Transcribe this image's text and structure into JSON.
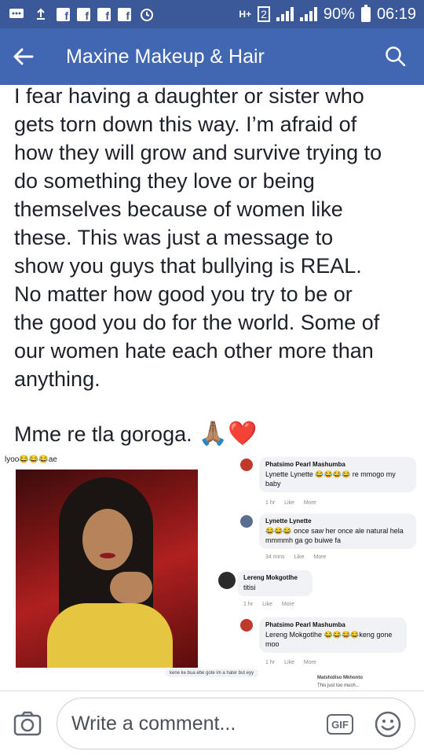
{
  "status_bar": {
    "battery": "90%",
    "time": "06:19",
    "network": "H+",
    "sim_slot": "2",
    "icons": [
      "message-icon",
      "upload-icon",
      "facebook-icon",
      "facebook-icon",
      "facebook-icon",
      "facebook-icon",
      "alarm-icon"
    ]
  },
  "app_bar": {
    "title": "Maxine Makeup & Hair",
    "color": "#4267b2"
  },
  "post": {
    "body": "I fear having a daughter or sister who\ngets torn down this way. I’m afraid of\nhow they will grow and survive trying to\ndo something they love or being\nthemselves because of women like\nthese. This was just a message to\nshow you guys that bullying is REAL.\nNo matter how good you try to be or\nthe good you do for the world. Some of\nour women hate each other more than\nanything.",
    "closing": "Mme re tla goroga.",
    "closing_emoji": "🙏🏽❤️"
  },
  "screenshot": {
    "caption": "lyoo😂😂😂ae",
    "comments": [
      {
        "name": "Phatsimo Pearl Mashumba",
        "text": "Lynette Lynette 😂😂😂😂 re mmogo my baby",
        "time": "1 hr",
        "like": "Like",
        "more": "More"
      },
      {
        "name": "Lynette Lynette",
        "text": "😂😂😂 once saw her once ale natural hela mmmmh ga go buiwe fa",
        "time": "34 mins",
        "like": "Like",
        "more": "More"
      },
      {
        "name": "Lereng Mokgotlhe",
        "text": "titisi",
        "time": "1 hr",
        "like": "Like",
        "more": "More"
      },
      {
        "name": "Phatsimo Pearl Mashumba",
        "text": "Lereng Mokgotlhe 😂😂😂😂keng gone moo",
        "time": "1 hr",
        "like": "Like",
        "more": "More"
      }
    ],
    "bottom_snippets": [
      "kene ke bua ebe gote im a hater but eyy",
      "Matshidiso Mkhonto",
      "This just too much..."
    ]
  },
  "comment_bar": {
    "placeholder": "Write a comment...",
    "gif_label": "GIF"
  }
}
